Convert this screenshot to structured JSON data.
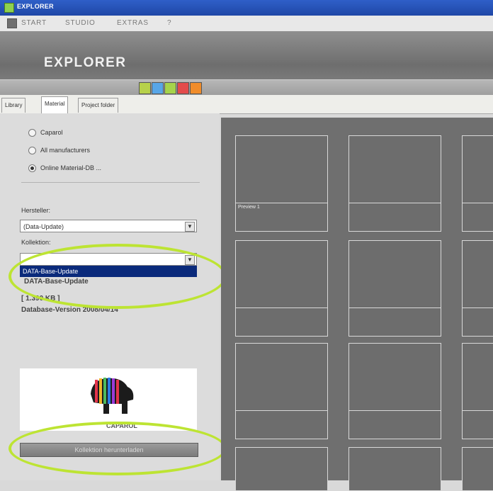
{
  "window": {
    "title": "EXPLORER"
  },
  "menubar": {
    "items": [
      "START",
      "STUDIO",
      "EXTRAS",
      "?"
    ]
  },
  "banner": {
    "title": "EXPLORER"
  },
  "toolbar": {
    "buttons": [
      {
        "icon": "save-icon",
        "color": "#b7d14a"
      },
      {
        "icon": "open-icon",
        "color": "#58a6e7"
      },
      {
        "icon": "new-icon",
        "color": "#a6d34a"
      },
      {
        "icon": "delete-icon",
        "color": "#e34b4b"
      },
      {
        "icon": "settings-icon",
        "color": "#f08c2a"
      }
    ]
  },
  "tabs": {
    "labels": [
      "Library",
      "Material",
      "Project folder"
    ],
    "active": "Material"
  },
  "radio_options": [
    {
      "label": "Caparol",
      "checked": false
    },
    {
      "label": "All manufacturers",
      "checked": false
    },
    {
      "label": "Online Material-DB ...",
      "checked": true
    }
  ],
  "manufacturer": {
    "label": "Hersteller:",
    "value": "(Data-Update)"
  },
  "collection": {
    "label": "Kollektion:",
    "value": "",
    "dropdown_option": "DATA-Base-Update"
  },
  "info": {
    "name": "DATA-Base-Update",
    "size": "[ 1.390 KB ]",
    "version": "Database-Version 2008/04/14"
  },
  "logo": {
    "text": "CAPAROL"
  },
  "reload_button": {
    "label": "Kollektion herunterladen"
  },
  "preview": {
    "first_label": "Preview 1"
  },
  "colors": {
    "highlight": "#bde433",
    "selection": "#0a2a7b",
    "preview_bg": "#6f6f6f"
  }
}
